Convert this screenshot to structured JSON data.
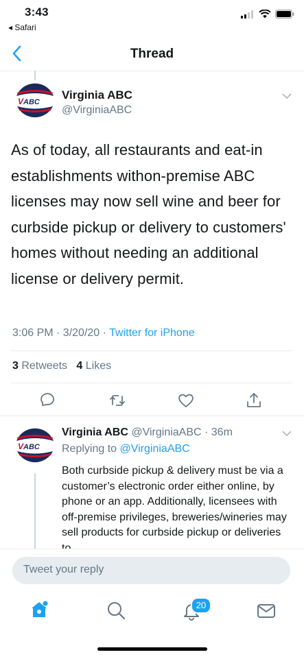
{
  "status_bar": {
    "time": "3:43",
    "back_app": "◂ Safari"
  },
  "nav": {
    "title": "Thread"
  },
  "main_tweet": {
    "name": "Virginia ABC",
    "handle": "@VirginiaABC",
    "text": "As of today, all restaurants and eat-in establishments withon-premise ABC licenses may now sell wine and beer for curbside pickup or delivery to customers' homes without needing an additional license or delivery permit.",
    "timestamp": "3:06 PM · 3/20/20 · ",
    "source": "Twitter for iPhone",
    "retweets_count": "3",
    "retweets_label": " Retweets",
    "likes_count": "4",
    "likes_label": " Likes"
  },
  "reply_tweet": {
    "name": "Virginia ABC",
    "handle_time": " @VirginiaABC · 36m",
    "replying_prefix": "Replying to ",
    "replying_to": "@VirginiaABC",
    "text": "Both curbside pickup & delivery must be via a customer’s electronic order either online, by phone or an app. Additionally, licensees with off-premise privileges, breweries/wineries may sell products for curbside pickup or deliveries to"
  },
  "reply_box": {
    "placeholder": "Tweet your reply"
  },
  "tab_bar": {
    "notifications_badge": "20"
  },
  "logo": {
    "text": "ABC"
  },
  "colors": {
    "accent": "#1da1f2",
    "secondary_text": "#657786",
    "divider": "#e6ecf0",
    "logo_navy": "#1b2a5c",
    "logo_red": "#c8102e"
  },
  "icons": [
    "back-chevron-icon",
    "signal-icon",
    "wifi-icon",
    "battery-icon",
    "caret-down-icon",
    "reply-icon",
    "retweet-icon",
    "like-icon",
    "share-icon",
    "home-icon",
    "search-icon",
    "notifications-icon",
    "messages-icon"
  ]
}
